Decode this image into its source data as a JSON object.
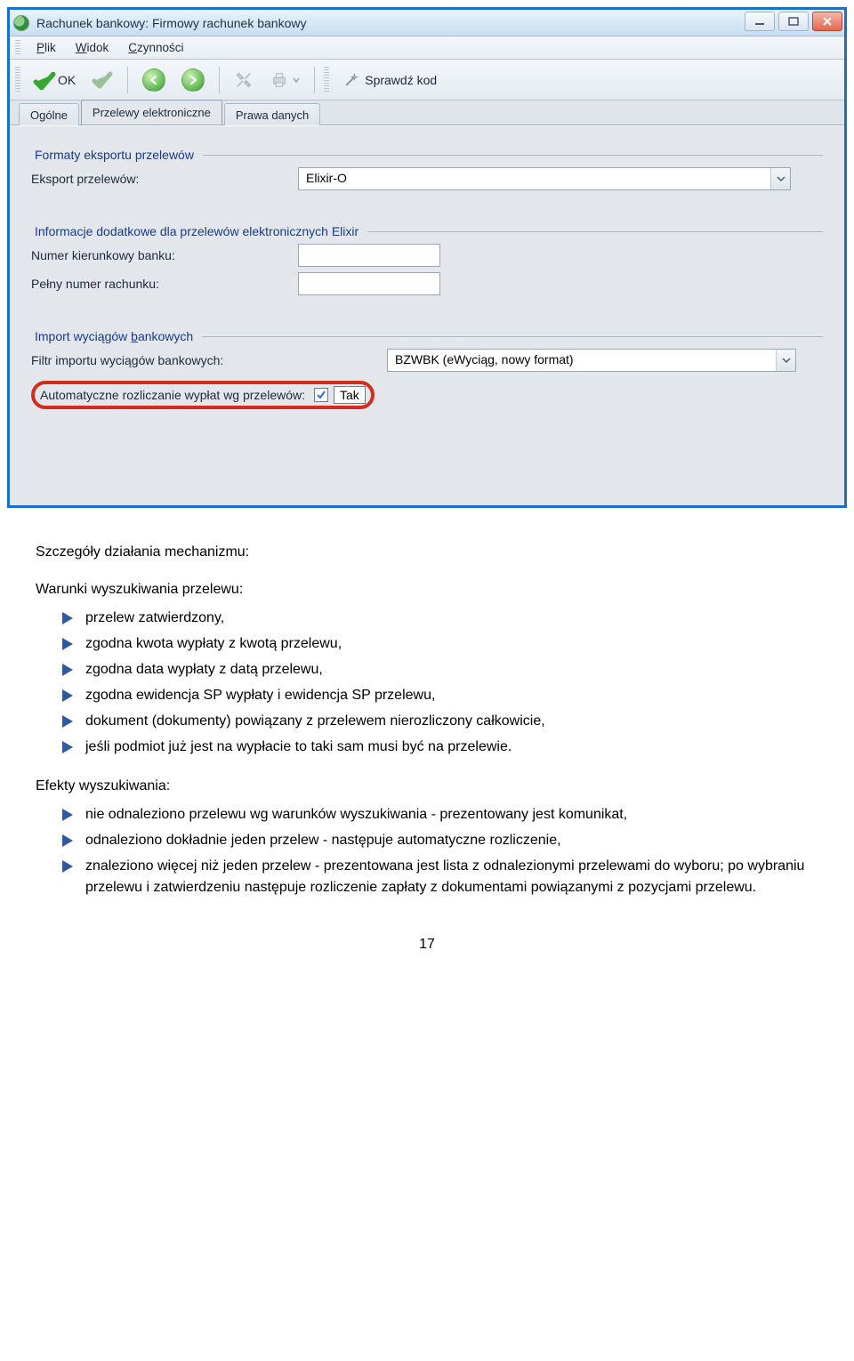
{
  "window": {
    "title": "Rachunek bankowy: Firmowy rachunek bankowy"
  },
  "menu": {
    "file": "Plik",
    "view": "Widok",
    "actions": "Czynności"
  },
  "toolbar": {
    "ok": "OK",
    "verify": "Sprawdź kod"
  },
  "tabs": {
    "general": "Ogólne",
    "transfers": "Przelewy elektroniczne",
    "rights": "Prawa danych"
  },
  "groups": {
    "export": {
      "legend": "Formaty eksportu przelewów",
      "label_export": "Eksport przelewów:",
      "value_export": "Elixir-O"
    },
    "elixir": {
      "legend": "Informacje dodatkowe dla przelewów elektronicznych Elixir",
      "label_bankcode": "Numer kierunkowy banku:",
      "label_account": "Pełny numer rachunku:"
    },
    "import": {
      "legend": "Import wyciągów bankowych",
      "label_filter": "Filtr importu wyciągów bankowych:",
      "value_filter": "BZWBK (eWyciąg, nowy format)",
      "label_auto": "Automatyczne rozliczanie wypłat wg przelewów:",
      "value_auto": "Tak"
    }
  },
  "doc": {
    "heading": "Szczegóły działania mechanizmu:",
    "sub1": "Warunki wyszukiwania przelewu:",
    "cond": [
      "przelew zatwierdzony,",
      "zgodna kwota wypłaty z kwotą przelewu,",
      "zgodna data wypłaty z datą przelewu,",
      "zgodna ewidencja SP wypłaty i ewidencja SP przelewu,",
      "dokument (dokumenty) powiązany z przelewem nierozliczony całkowicie,",
      "jeśli podmiot już jest na wypłacie to taki sam musi być na przelewie."
    ],
    "sub2": "Efekty wyszukiwania:",
    "eff": [
      "nie odnaleziono przelewu wg warunków wyszukiwania - prezentowany jest komunikat,",
      "odnaleziono dokładnie jeden przelew - następuje automatyczne rozliczenie,",
      "znaleziono więcej niż jeden przelew - prezentowana jest lista z odnalezionymi przelewami do wyboru; po wybraniu przelewu i zatwierdzeniu następuje rozliczenie zapłaty z dokumentami powiązanymi z pozycjami przelewu."
    ],
    "page": "17"
  }
}
